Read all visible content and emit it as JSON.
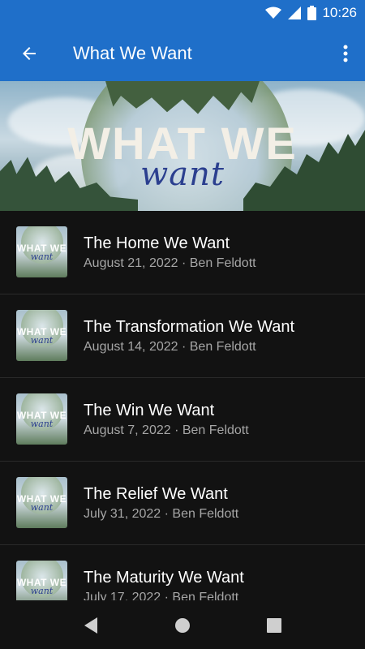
{
  "status_bar": {
    "time": "10:26"
  },
  "app_bar": {
    "title": "What We Want"
  },
  "hero": {
    "title_main": "WHAT WE",
    "title_script": "want"
  },
  "thumb": {
    "main": "WHAT WE",
    "script": "want"
  },
  "sermons": [
    {
      "title": "The Home We Want",
      "meta": "August 21, 2022 · Ben Feldott"
    },
    {
      "title": "The Transformation We Want",
      "meta": "August 14, 2022 · Ben Feldott"
    },
    {
      "title": "The Win We Want",
      "meta": "August 7, 2022 · Ben Feldott"
    },
    {
      "title": "The Relief We Want",
      "meta": "July 31, 2022 · Ben Feldott"
    },
    {
      "title": "The Maturity We Want",
      "meta": "July 17, 2022 · Ben Feldott"
    }
  ],
  "colors": {
    "app_bar": "#1f6fc9",
    "background": "#121212",
    "meta_text": "#a6a6a6"
  }
}
